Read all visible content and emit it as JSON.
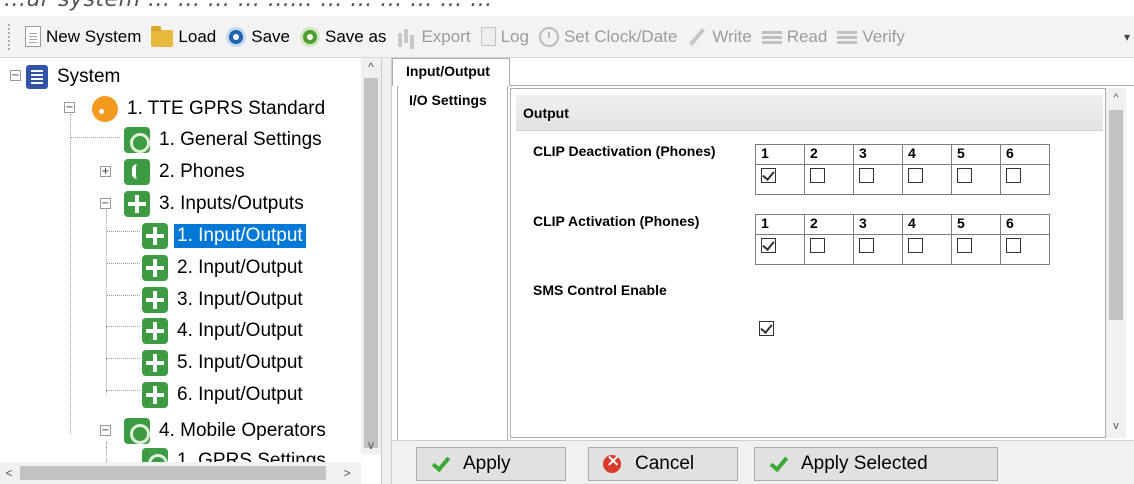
{
  "caption_fragment": "...ur system ... ... ... ... ...... ... ... ... ... ... ...",
  "toolbar": {
    "items": [
      {
        "label": "New System",
        "icon": "new-document-icon",
        "enabled": true
      },
      {
        "label": "Load",
        "icon": "folder-icon",
        "enabled": true
      },
      {
        "label": "Save",
        "icon": "save-disk-icon",
        "enabled": true
      },
      {
        "label": "Save as",
        "icon": "save-as-disk-icon",
        "enabled": true
      },
      {
        "label": "Export",
        "icon": "export-bars-icon",
        "enabled": false
      },
      {
        "label": "Log",
        "icon": "log-icon",
        "enabled": false
      },
      {
        "label": "Set Clock/Date",
        "icon": "clock-icon",
        "enabled": false
      },
      {
        "label": "Write",
        "icon": "pen-icon",
        "enabled": false
      },
      {
        "label": "Read",
        "icon": "read-icon",
        "enabled": false
      },
      {
        "label": "Verify",
        "icon": "verify-icon",
        "enabled": false
      }
    ]
  },
  "tree": {
    "nodes": [
      {
        "label": "System",
        "expander": "−"
      },
      {
        "label": "1. TTE GPRS Standard",
        "expander": "−"
      },
      {
        "label": "1. General Settings",
        "expander": ""
      },
      {
        "label": "2. Phones",
        "expander": "+"
      },
      {
        "label": "3. Inputs/Outputs",
        "expander": "−"
      },
      {
        "label": "1. Input/Output",
        "expander": "",
        "selected": true
      },
      {
        "label": "2. Input/Output",
        "expander": ""
      },
      {
        "label": "3. Input/Output",
        "expander": ""
      },
      {
        "label": "4. Input/Output",
        "expander": ""
      },
      {
        "label": "5. Input/Output",
        "expander": ""
      },
      {
        "label": "6. Input/Output",
        "expander": ""
      },
      {
        "label": "4. Mobile Operators",
        "expander": "−"
      },
      {
        "label": "1. GPRS Settings",
        "expander": ""
      }
    ]
  },
  "tabs": {
    "top": "Input/Output",
    "side": "I/O Settings"
  },
  "panel": {
    "title": "Output",
    "clip_deactivation": {
      "label": "CLIP Deactivation (Phones)",
      "headers": [
        "1",
        "2",
        "3",
        "4",
        "5",
        "6"
      ],
      "checked": [
        true,
        false,
        false,
        false,
        false,
        false
      ]
    },
    "clip_activation": {
      "label": "CLIP Activation (Phones)",
      "headers": [
        "1",
        "2",
        "3",
        "4",
        "5",
        "6"
      ],
      "checked": [
        true,
        false,
        false,
        false,
        false,
        false
      ]
    },
    "sms_control": {
      "label": "SMS Control Enable",
      "checked": true
    }
  },
  "buttons": {
    "apply": "Apply",
    "cancel": "Cancel",
    "apply_selected": "Apply Selected"
  },
  "colors": {
    "selection": "#0078d7",
    "node_green": "#3d9b43",
    "rss_orange": "#f39a1f"
  }
}
